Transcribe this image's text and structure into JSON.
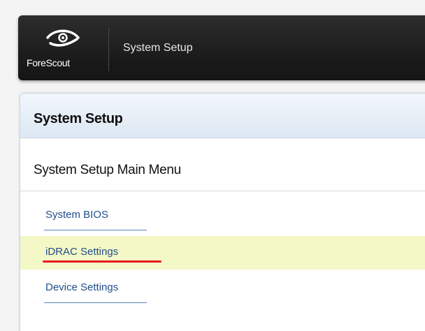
{
  "header": {
    "logo_text": "ForeScout",
    "title": "System Setup",
    "logo_icon": "eye-swoosh-icon"
  },
  "panel": {
    "title": "System Setup",
    "menu_title": "System Setup Main Menu",
    "items": [
      {
        "label": "System BIOS",
        "selected": false
      },
      {
        "label": "iDRAC Settings",
        "selected": true
      },
      {
        "label": "Device Settings",
        "selected": false
      }
    ]
  },
  "colors": {
    "header_bg": "#1a1a1a",
    "selected_row": "#f4f7c6",
    "link": "#1f4e8c",
    "annotation": "#e41a1a"
  }
}
